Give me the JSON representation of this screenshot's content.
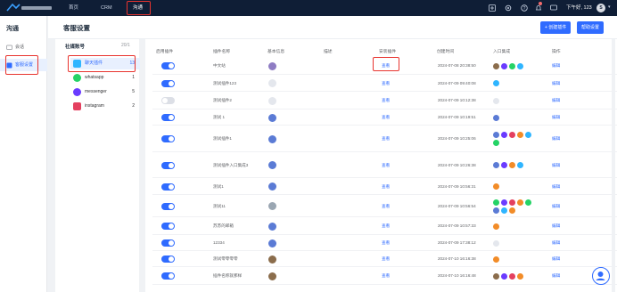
{
  "topbar": {
    "nav": [
      "首页",
      "CRM",
      "沟通"
    ],
    "time": "下午好, 123",
    "user_initial": "S"
  },
  "leftnav": {
    "title": "沟通",
    "items": [
      {
        "label": "会话",
        "icon": "chat-icon"
      },
      {
        "label": "客服设置",
        "icon": "settings-icon"
      }
    ]
  },
  "page": {
    "title": "客服设置",
    "add_button": "+ 创建插件",
    "help_button": "帮助设置"
  },
  "social": {
    "title": "社媒账号",
    "count": "20/1",
    "items": [
      {
        "label": "聊天插件",
        "count": "13",
        "icon": "widget-icon",
        "color": "#2fb5ff"
      },
      {
        "label": "whatsapp",
        "count": "1",
        "icon": "whatsapp-icon",
        "color": "#25d366"
      },
      {
        "label": "messenger",
        "count": "5",
        "icon": "messenger-icon",
        "color": "#6a3bff"
      },
      {
        "label": "instagram",
        "count": "2",
        "icon": "instagram-icon",
        "color": "#e4405f"
      }
    ]
  },
  "table": {
    "headers": [
      "启用插件",
      "插件名称",
      "基本信息",
      "描述",
      "安装插件",
      "创建时间",
      "入口集成",
      "操作"
    ],
    "rows": [
      {
        "on": true,
        "name": "中文站",
        "install": "查看",
        "time": "2024-07-08 20:38:50",
        "op": "编辑"
      },
      {
        "on": true,
        "name": "测试插件123",
        "install": "查看",
        "time": "2024-07-09 09:40:08",
        "op": "编辑"
      },
      {
        "on": false,
        "name": "测试插件2",
        "install": "查看",
        "time": "2024-07-09 10:12:38",
        "op": "编辑"
      },
      {
        "on": true,
        "name": "测试 1",
        "install": "查看",
        "time": "2024-07-09 10:19:51",
        "op": "编辑"
      },
      {
        "on": true,
        "name": "测试插件1",
        "install": "查看",
        "time": "2024-07-09 10:25:06",
        "op": "编辑"
      },
      {
        "on": true,
        "name": "测试插件入口集成3",
        "install": "查看",
        "time": "2024-07-09 10:26:38",
        "op": "编辑"
      },
      {
        "on": true,
        "name": "测试1",
        "install": "查看",
        "time": "2024-07-09 10:56:31",
        "op": "编辑"
      },
      {
        "on": true,
        "name": "测试11",
        "install": "查看",
        "time": "2024-07-09 10:56:54",
        "op": "编辑"
      },
      {
        "on": true,
        "name": "苏苏的邮箱",
        "install": "查看",
        "time": "2024-07-09 10:57:33",
        "op": "编辑"
      },
      {
        "on": true,
        "name": "12334",
        "install": "查看",
        "time": "2024-07-09 17:38:12",
        "op": "编辑"
      },
      {
        "on": true,
        "name": "测试零零零零",
        "install": "查看",
        "time": "2024-07-10 16:16:38",
        "op": "编辑"
      },
      {
        "on": true,
        "name": "插件名称就那样",
        "install": "查看",
        "time": "2024-07-10 16:16:48",
        "op": "编辑"
      }
    ]
  }
}
